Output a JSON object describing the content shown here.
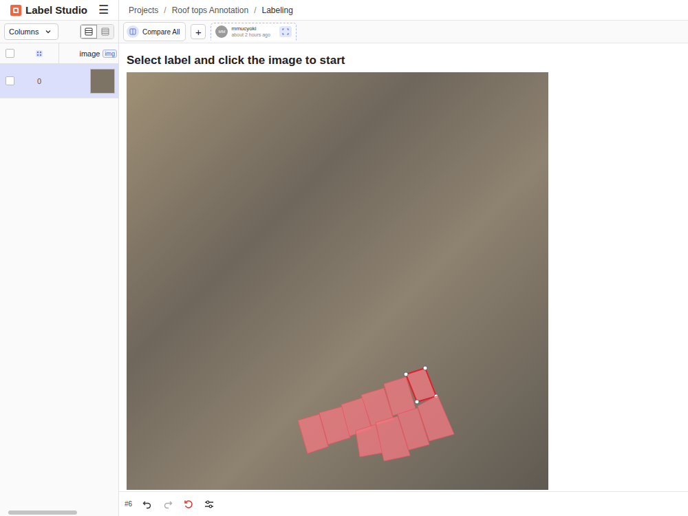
{
  "app": {
    "logo": "Label Studio",
    "menu": "☰"
  },
  "breadcrumb": [
    {
      "label": "Projects"
    },
    {
      "label": "Roof tops Annotation"
    },
    {
      "label": "Labeling"
    }
  ],
  "breadcrumb_separator": "/",
  "sidebar": {
    "columns_button": "Columns",
    "views": [
      {
        "kind": "list",
        "selected": true
      },
      {
        "kind": "grid",
        "selected": false
      }
    ],
    "header": {
      "checked": false,
      "column": "image",
      "tag": "img"
    },
    "rows": [
      {
        "id": "0",
        "selected": true,
        "checked": false
      }
    ]
  },
  "tabs": {
    "compare": "Compare All",
    "add": "+",
    "annotations": [
      {
        "user": "mmucyoki",
        "initials": "MM",
        "time": "about 2 hours ago",
        "selected": true
      }
    ]
  },
  "instruction": "Select label and click the image to start",
  "regions": [
    {
      "selected": false
    },
    {
      "selected": false
    },
    {
      "selected": false
    },
    {
      "selected": false
    },
    {
      "selected": false
    },
    {
      "selected": true
    },
    {
      "selected": false
    },
    {
      "selected": false
    },
    {
      "selected": false
    },
    {
      "selected": false
    }
  ],
  "toolbar": {
    "task": "#6"
  }
}
